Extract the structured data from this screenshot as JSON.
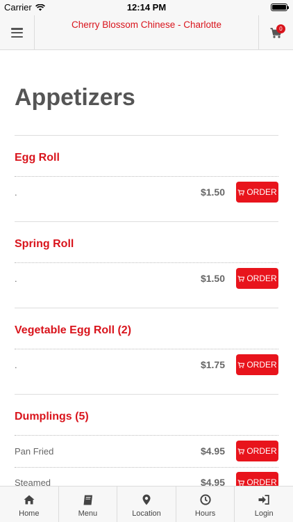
{
  "status_bar": {
    "carrier": "Carrier",
    "time": "12:14 PM"
  },
  "header": {
    "title": "Cherry Blossom Chinese - Charlotte",
    "cart_count": "0"
  },
  "page": {
    "title": "Appetizers"
  },
  "items": [
    {
      "name": "Egg Roll",
      "variants": [
        {
          "label": ".",
          "price": "$1.50",
          "order_label": "ORDER"
        }
      ]
    },
    {
      "name": "Spring Roll",
      "variants": [
        {
          "label": ".",
          "price": "$1.50",
          "order_label": "ORDER"
        }
      ]
    },
    {
      "name": "Vegetable Egg Roll (2)",
      "variants": [
        {
          "label": ".",
          "price": "$1.75",
          "order_label": "ORDER"
        }
      ]
    },
    {
      "name": "Dumplings (5)",
      "variants": [
        {
          "label": "Pan Fried",
          "price": "$4.95",
          "order_label": "ORDER"
        },
        {
          "label": "Steamed",
          "price": "$4.95",
          "order_label": "ORDER"
        }
      ]
    }
  ],
  "bottom_nav": [
    {
      "label": "Home",
      "icon": "home-icon"
    },
    {
      "label": "Menu",
      "icon": "book-icon"
    },
    {
      "label": "Location",
      "icon": "map-pin-icon"
    },
    {
      "label": "Hours",
      "icon": "clock-icon"
    },
    {
      "label": "Login",
      "icon": "sign-in-icon"
    }
  ],
  "colors": {
    "accent": "#d9141c",
    "button": "#e8141c",
    "text": "#555555"
  }
}
